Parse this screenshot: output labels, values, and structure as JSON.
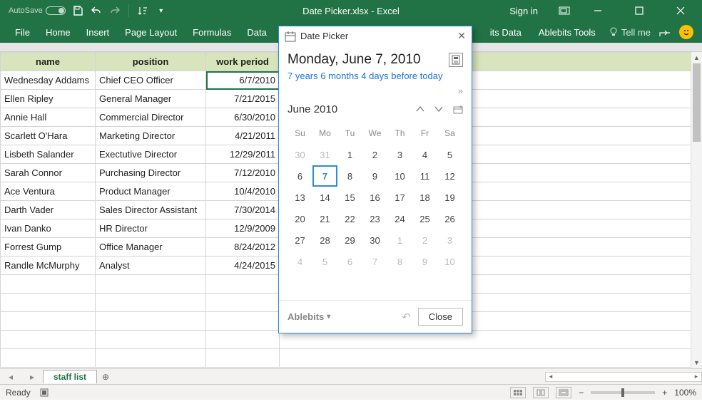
{
  "titlebar": {
    "autosave": "AutoSave",
    "autosave_state": "Off",
    "doc": "Date Picker.xlsx  -  Excel",
    "signin": "Sign in"
  },
  "ribbon": {
    "tabs": [
      "File",
      "Home",
      "Insert",
      "Page Layout",
      "Formulas",
      "Data"
    ],
    "right": [
      "its Data",
      "Ablebits Tools"
    ],
    "tellme": "Tell me"
  },
  "headers": [
    "name",
    "position",
    "work period"
  ],
  "rows": [
    {
      "name": "Wednesday Addams",
      "pos": "Chief CEO Officer",
      "date": "6/7/2010",
      "sel": true
    },
    {
      "name": "Ellen Ripley",
      "pos": "General Manager",
      "date": "7/21/2015"
    },
    {
      "name": "Annie Hall",
      "pos": "Commercial Director",
      "date": "6/30/2010"
    },
    {
      "name": "Scarlett O'Hara",
      "pos": "Marketing Director",
      "date": "4/21/2011"
    },
    {
      "name": "Lisbeth Salander",
      "pos": "Exectutive Director",
      "date": "12/29/2011"
    },
    {
      "name": "Sarah Connor",
      "pos": "Purchasing Director",
      "date": "7/12/2010"
    },
    {
      "name": "Ace Ventura",
      "pos": "Product Manager",
      "date": "10/4/2010"
    },
    {
      "name": "Darth Vader",
      "pos": "Sales Director Assistant",
      "date": "7/30/2014"
    },
    {
      "name": "Ivan Danko",
      "pos": "HR Director",
      "date": "12/9/2009"
    },
    {
      "name": "Forrest Gump",
      "pos": "Office Manager",
      "date": "8/24/2012"
    },
    {
      "name": "Randle McMurphy",
      "pos": "Analyst",
      "date": "4/24/2015"
    }
  ],
  "sheettab": "staff list",
  "status": {
    "ready": "Ready",
    "zoom": "100%"
  },
  "pane": {
    "title": "Date Picker",
    "big_date": "Monday, June 7, 2010",
    "diff": "7 years 6 months 4 days before today",
    "month": "June 2010",
    "dow": [
      "Su",
      "Mo",
      "Tu",
      "We",
      "Th",
      "Fr",
      "Sa"
    ],
    "weeks": [
      [
        {
          "d": 30,
          "dim": true
        },
        {
          "d": 31,
          "dim": true
        },
        {
          "d": 1
        },
        {
          "d": 2
        },
        {
          "d": 3
        },
        {
          "d": 4
        },
        {
          "d": 5
        }
      ],
      [
        {
          "d": 6
        },
        {
          "d": 7,
          "sel": true
        },
        {
          "d": 8
        },
        {
          "d": 9
        },
        {
          "d": 10
        },
        {
          "d": 11
        },
        {
          "d": 12
        }
      ],
      [
        {
          "d": 13
        },
        {
          "d": 14
        },
        {
          "d": 15
        },
        {
          "d": 16
        },
        {
          "d": 17
        },
        {
          "d": 18
        },
        {
          "d": 19
        }
      ],
      [
        {
          "d": 20
        },
        {
          "d": 21
        },
        {
          "d": 22
        },
        {
          "d": 23
        },
        {
          "d": 24
        },
        {
          "d": 25
        },
        {
          "d": 26
        }
      ],
      [
        {
          "d": 27
        },
        {
          "d": 28
        },
        {
          "d": 29
        },
        {
          "d": 30
        },
        {
          "d": 1,
          "dim": true
        },
        {
          "d": 2,
          "dim": true
        },
        {
          "d": 3,
          "dim": true
        }
      ],
      [
        {
          "d": 4,
          "dim": true
        },
        {
          "d": 5,
          "dim": true
        },
        {
          "d": 6,
          "dim": true
        },
        {
          "d": 7,
          "dim": true
        },
        {
          "d": 8,
          "dim": true
        },
        {
          "d": 9,
          "dim": true
        },
        {
          "d": 10,
          "dim": true
        }
      ]
    ],
    "brand": "Ablebits",
    "close": "Close"
  }
}
